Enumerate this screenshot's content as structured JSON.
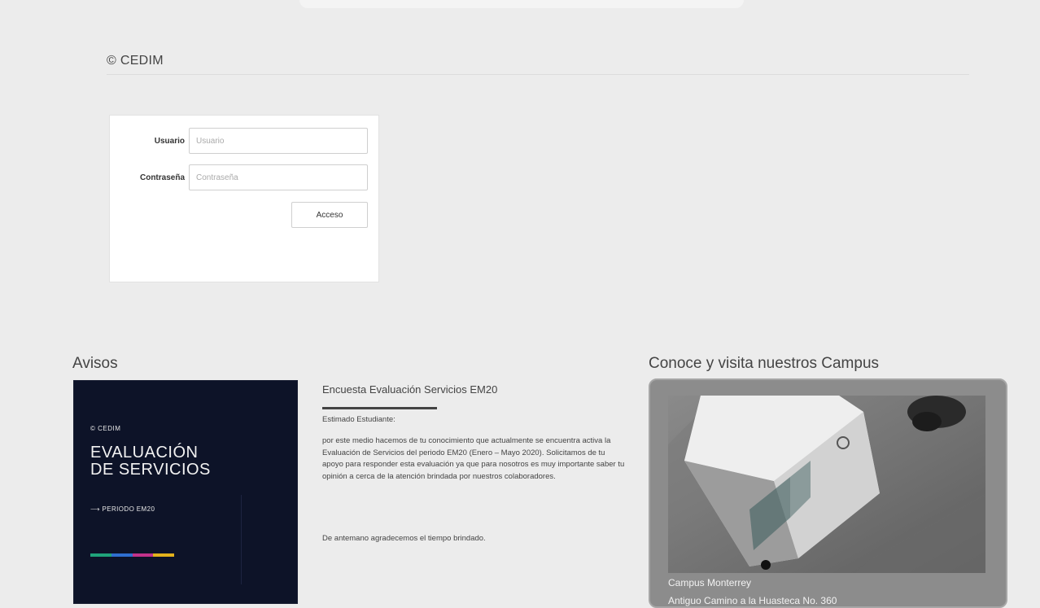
{
  "header": {
    "brand": "© CEDIM"
  },
  "login": {
    "user_label": "Usuario",
    "user_placeholder": "Usuario",
    "pass_label": "Contraseña",
    "pass_placeholder": "Contraseña",
    "submit_label": "Acceso"
  },
  "avisos": {
    "title": "Avisos",
    "promo": {
      "brand": "© CEDIM",
      "title_line1": "EVALUACIÓN",
      "title_line2": "DE SERVICIOS",
      "period": "⟶ PERIODO EM20",
      "bar_colors": [
        "#1fa37a",
        "#2f6fd0",
        "#c2328a",
        "#e2b11c"
      ]
    },
    "news": {
      "title": "Encuesta Evaluación Servicios EM20",
      "greeting": "Estimado Estudiante:",
      "body": "por este medio hacemos de tu conocimiento que actualmente se encuentra activa la Evaluación de Servicios del periodo EM20 (Enero – Mayo 2020). Solicitamos de tu apoyo para responder esta evaluación ya que para nosotros es muy importante saber tu opinión a cerca de la atención brindada por nuestros colaboradores.",
      "closing": "De antemano agradecemos el tiempo brindado."
    }
  },
  "campus": {
    "title": "Conoce y visita nuestros Campus",
    "name": "Campus Monterrey",
    "address": "Antiguo Camino a la Huasteca No. 360"
  },
  "colors": {
    "page_bg": "#ececec",
    "promo_bg": "#0d1328",
    "campus_card_bg": "#8c8c8c"
  }
}
